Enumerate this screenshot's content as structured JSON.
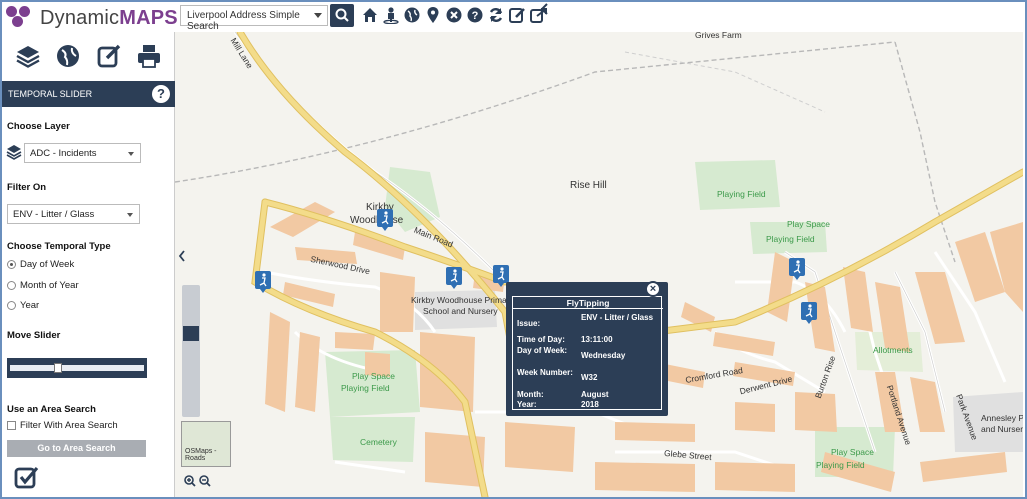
{
  "header": {
    "logo_prefix": "Dynamic",
    "logo_suffix": "MAPS",
    "search_select": "Liverpool Address Simple Search",
    "toolbar_icons": [
      "home-icon",
      "person-icon",
      "globe-icon",
      "map-pin-icon",
      "close-circle-icon",
      "help-circle-icon",
      "refresh-icon",
      "edit-icon",
      "share-icon"
    ]
  },
  "sidebar": {
    "tools": [
      "layers-icon",
      "globe-icon",
      "edit-icon",
      "print-icon"
    ],
    "panel_title": "TEMPORAL SLIDER",
    "help": "?",
    "choose_layer_label": "Choose Layer",
    "layer_value": "ADC - Incidents",
    "filter_on_label": "Filter On",
    "filter_value": "ENV - Litter / Glass",
    "temporal_type_label": "Choose Temporal Type",
    "temporal_options": [
      "Day of Week",
      "Month of Year",
      "Year"
    ],
    "selected_temporal": "Day of Week",
    "move_slider_label": "Move Slider",
    "slider_position": 0.35,
    "area_search_label": "Use an Area Search",
    "filter_area_label": "Filter With Area Search",
    "go_button": "Go to Area Search"
  },
  "map": {
    "labels": {
      "grives_farm": "Grives Farm",
      "mill_lane": "Mill Lane",
      "rise_hill": "Rise Hill",
      "kirkby_1": "Kirkby",
      "kirkby_2": "Woodhouse",
      "playing_field_1": "Playing Field",
      "play_space_1": "Play Space",
      "playing_field_2": "Playing Field",
      "main_road": "Main Road",
      "sherwood_drive": "Sherwood Drive",
      "school_1": "Kirkby Woodhouse Primar",
      "school_2": "School and Nursery",
      "play_space_2": "Play Space",
      "playing_field_3": "Playing Field",
      "cemetery": "Cemetery",
      "allotments": "Allotments",
      "play_space_3": "Play Space",
      "playing_field_4": "Playing Field",
      "annesley_1": "Annesley Pr",
      "annesley_2": "and Nursery",
      "glebe_street": "Glebe Street",
      "derwent_drive": "Derwent Drive",
      "cromford_road": "Cromford Road",
      "burton_rise": "Burton Rise",
      "portland_avenue": "Portland Avenue",
      "park_avenue": "Park Avenue",
      "basemap": "OSMaps - Roads"
    },
    "zoom_level": 0.35
  },
  "popup": {
    "title": "FlyTipping",
    "close": "×",
    "rows": [
      {
        "k": "Issue:",
        "v": "ENV - Litter / Glass"
      },
      {
        "k": "Time of Day:",
        "v": "13:11:00"
      },
      {
        "k": "Day of Week:",
        "v": "Wednesday"
      },
      {
        "k": "Week Number:",
        "v": "W32"
      },
      {
        "k": "Month:",
        "v": "August"
      },
      {
        "k": "Year:",
        "v": "2018"
      }
    ]
  },
  "colors": {
    "navy": "#2c3e56",
    "brand": "#7c3f8f",
    "road_major": "#f3dc8a",
    "building": "#f2c9a3",
    "green": "#d6ead0"
  }
}
